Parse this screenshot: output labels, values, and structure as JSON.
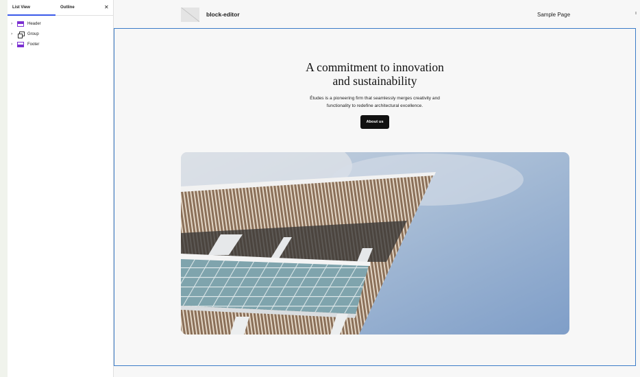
{
  "panel": {
    "tabs": [
      {
        "label": "List View"
      },
      {
        "label": "Outline"
      }
    ],
    "close_icon": "close-icon",
    "tree": [
      {
        "label": "Header",
        "icon": "header-block-icon"
      },
      {
        "label": "Group",
        "icon": "group-block-icon"
      },
      {
        "label": "Footer",
        "icon": "footer-block-icon"
      }
    ]
  },
  "site": {
    "title": "block-editor",
    "nav": [
      "Sample Page"
    ]
  },
  "hero": {
    "heading_line1": "A commitment to innovation",
    "heading_line2": "and sustainability",
    "text_line1": "Études is a pioneering firm that seamlessly merges creativity and",
    "text_line2": "functionality to redefine architectural excellence.",
    "button": "About us"
  },
  "colors": {
    "accent": "#3858e9",
    "selection_outline": "#3a7bc8",
    "block_icon": "#7b2fd1",
    "button_bg": "#111111"
  }
}
